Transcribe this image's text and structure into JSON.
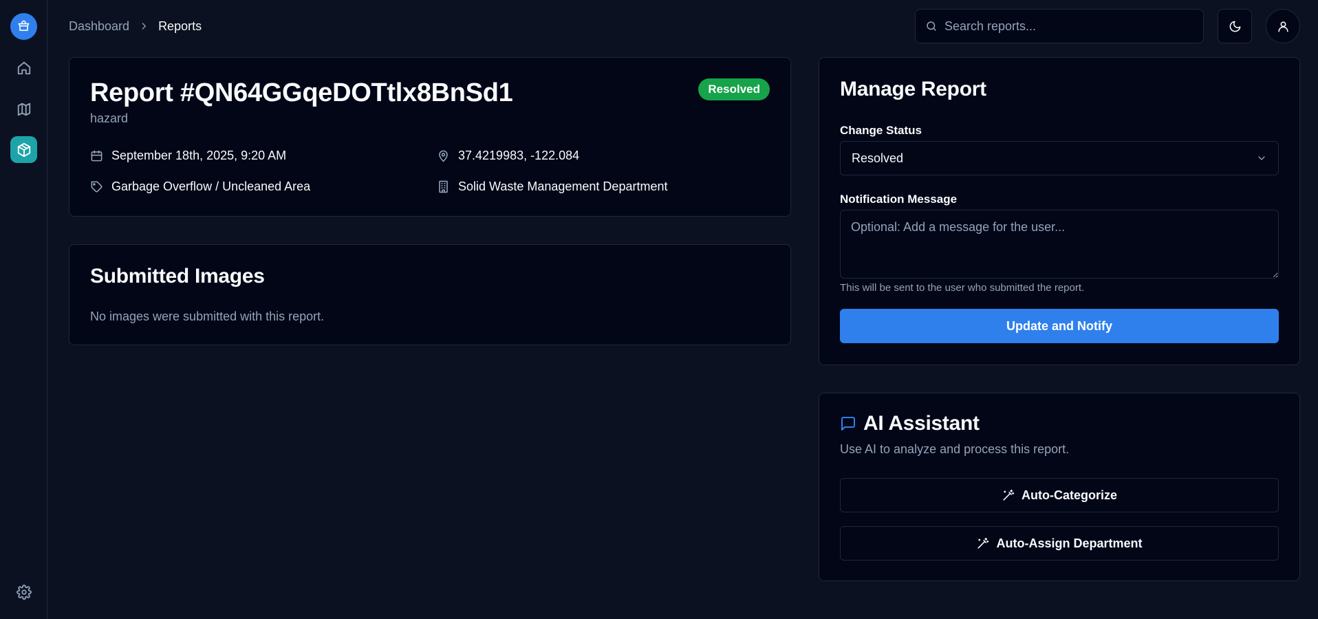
{
  "sidebar": {
    "logo_icon": "store-icon",
    "items": [
      {
        "name": "home",
        "icon": "home-icon",
        "active": false
      },
      {
        "name": "map",
        "icon": "map-icon",
        "active": false
      },
      {
        "name": "reports",
        "icon": "package-icon",
        "active": true
      }
    ],
    "settings_icon": "gear-icon",
    "accent": "#2f80ed",
    "active_color": "#1ea3a8"
  },
  "header": {
    "breadcrumb": [
      "Dashboard",
      "Reports"
    ],
    "search_placeholder": "Search reports...",
    "theme_icon": "moon-icon",
    "user_icon": "user-icon"
  },
  "report": {
    "title": "Report #QN64GGqeDOTtlx8BnSd1",
    "type": "hazard",
    "status": "Resolved",
    "status_color": "#16a34a",
    "date": "September 18th, 2025, 9:20 AM",
    "coordinates": "37.4219983, -122.084",
    "category": "Garbage Overflow / Uncleaned Area",
    "department": "Solid Waste Management Department"
  },
  "images": {
    "title": "Submitted Images",
    "empty_text": "No images were submitted with this report."
  },
  "manage": {
    "title": "Manage Report",
    "status_label": "Change Status",
    "status_value": "Resolved",
    "message_label": "Notification Message",
    "message_placeholder": "Optional: Add a message for the user...",
    "message_value": "",
    "helper": "This will be sent to the user who submitted the report.",
    "submit_label": "Update and Notify"
  },
  "ai": {
    "title": "AI Assistant",
    "description": "Use AI to analyze and process this report.",
    "categorize_label": "Auto-Categorize",
    "assign_label": "Auto-Assign Department"
  }
}
